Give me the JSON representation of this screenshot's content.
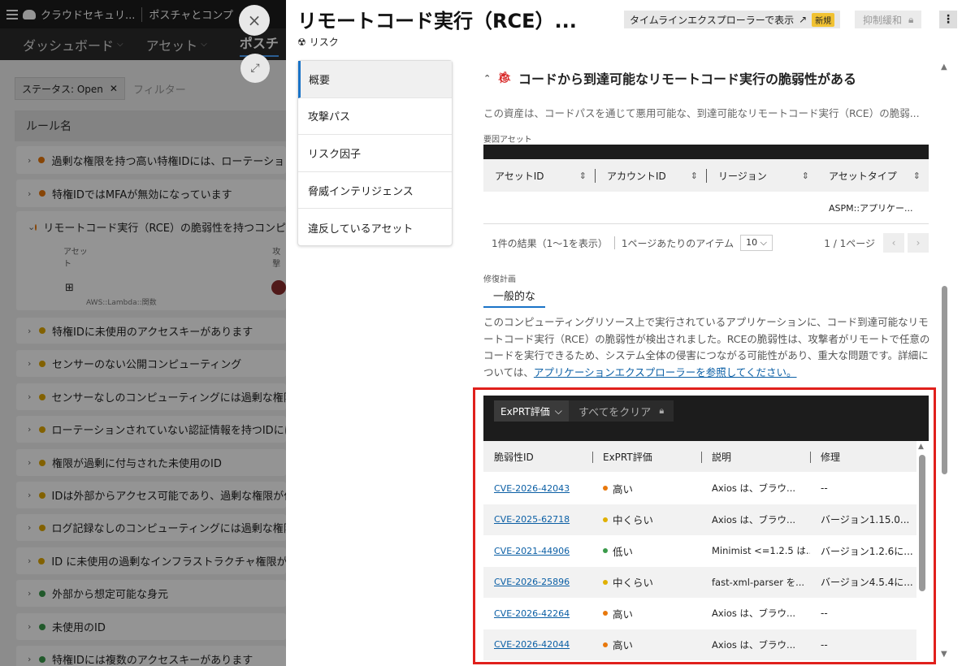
{
  "background": {
    "app_name": "クラウドセキュリ...",
    "breadcrumb": "ポスチャとコンプ",
    "nav": [
      {
        "label": "ダッシュボード"
      },
      {
        "label": "アセット"
      },
      {
        "label": "ポスチ"
      }
    ],
    "filter_chip": "ステータス: Open",
    "filter_placeholder": "フィルター",
    "column_header": "ルール名",
    "expanded_row": {
      "title": "リモートコード実行（RCE）の脆弱性を持つコンピ",
      "asset_label": "アセット",
      "attack_label": "攻撃",
      "asset_type": "AWS::Lambda::関数"
    },
    "rows": [
      {
        "title": "過剰な権限を持つ高い特権IDには、ローテーション",
        "color": "#e8780c"
      },
      {
        "title": "特権IDではMFAが無効になっています",
        "color": "#e8780c"
      },
      {
        "title": "特権IDに未使用のアクセスキーがあります",
        "color": "#e0a800"
      },
      {
        "title": "センサーのない公開コンピューティング",
        "color": "#e0a800"
      },
      {
        "title": "センサーなしのコンピューティングには過剰な権限",
        "color": "#e0a800"
      },
      {
        "title": "ローテーションされていない認証情報を持つIDには",
        "color": "#e0a800"
      },
      {
        "title": "権限が過剰に付与された未使用のID",
        "color": "#e0a800"
      },
      {
        "title": "IDは外部からアクセス可能であり、過剰な権限が付",
        "color": "#e0a800"
      },
      {
        "title": "ログ記録なしのコンピューティングには過剰な権限",
        "color": "#e0a800"
      },
      {
        "title": "ID に未使用の過剰なインフラストラクチャ権限があ",
        "color": "#e0a800"
      },
      {
        "title": "外部から想定可能な身元",
        "color": "#3a9a4a"
      },
      {
        "title": "未使用のID",
        "color": "#3a9a4a"
      },
      {
        "title": "特権IDには複数のアクセスキーがあります",
        "color": "#3a9a4a"
      }
    ]
  },
  "panel": {
    "title": "リモートコード実行（RCE）...",
    "subtitle": "リスク",
    "timeline_button": "タイムラインエクスプローラーで表示",
    "new_badge": "新規",
    "suppress_button": "抑制緩和",
    "side_nav": [
      {
        "label": "概要"
      },
      {
        "label": "攻撃パス"
      },
      {
        "label": "リスク因子"
      },
      {
        "label": "脅威インテリジェンス"
      },
      {
        "label": "違反しているアセット"
      }
    ],
    "risk_heading": "コードから到達可能なリモートコード実行の脆弱性がある",
    "risk_description": "この資産は、コードパスを通じて悪用可能な、到達可能なリモートコード実行（RCE）の脆弱...",
    "asset_section_label": "要因アセット",
    "asset_table": {
      "columns": [
        "アセットID",
        "アカウントID",
        "リージョン",
        "アセットタイプ"
      ],
      "rows": [
        [
          "",
          "",
          "",
          "ASPM::アプリケー..."
        ]
      ]
    },
    "pager": {
      "results": "1件の結果（1〜1を表示）",
      "per_page_label": "1ページあたりのアイテム",
      "per_page_value": "10",
      "page": "1 / 1ページ"
    },
    "remediation_label": "修復計画",
    "remediation_tab": "一般的な",
    "remediation_text": "このコンピューティングリソース上で実行されているアプリケーションに、コード到達可能なリモートコード実行（RCE）の脆弱性が検出されました。RCEの脆弱性は、攻撃者がリモートで任意のコードを実行できるため、システム全体の侵害につながる可能性があり、重大な問題です。詳細については、",
    "remediation_link": "アプリケーションエクスプローラーを参照してください。",
    "expert_filter": "ExPRT評価",
    "clear_all": "すべてをクリア",
    "vuln_columns": [
      "脆弱性ID",
      "ExPRT評価",
      "説明",
      "修理"
    ],
    "vulns": [
      {
        "id": "CVE-2026-42043",
        "severity": "高い",
        "color": "#e8780c",
        "desc": "Axios は、ブラウ...",
        "fix": "--"
      },
      {
        "id": "CVE-2025-62718",
        "severity": "中くらい",
        "color": "#e0b000",
        "desc": "Axios は、ブラウ...",
        "fix": "バージョン1.15.0..."
      },
      {
        "id": "CVE-2021-44906",
        "severity": "低い",
        "color": "#3a9a4a",
        "desc": "Minimist <=1.2.5 は...",
        "fix": "バージョン1.2.6に..."
      },
      {
        "id": "CVE-2026-25896",
        "severity": "中くらい",
        "color": "#e0b000",
        "desc": "fast-xml-parser を...",
        "fix": "バージョン4.5.4に..."
      },
      {
        "id": "CVE-2026-42264",
        "severity": "高い",
        "color": "#e8780c",
        "desc": "Axios は、ブラウ...",
        "fix": "--"
      },
      {
        "id": "CVE-2026-42044",
        "severity": "高い",
        "color": "#e8780c",
        "desc": "Axios は、ブラウ...",
        "fix": "--"
      }
    ]
  }
}
